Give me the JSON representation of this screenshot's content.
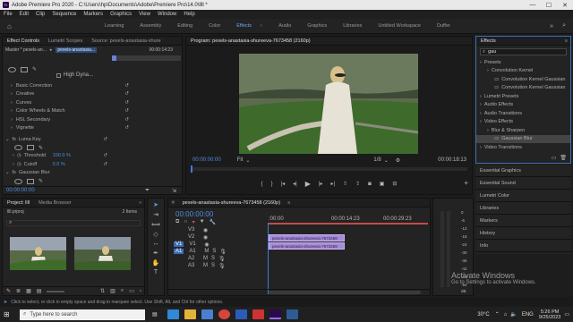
{
  "window": {
    "title": "Adobe Premiere Pro 2020 - C:\\Users\\hp\\Documents\\Adobe\\Premiere Pro\\14.0\\llll *",
    "min": "—",
    "max": "☐",
    "close": "✕"
  },
  "menu": [
    "File",
    "Edit",
    "Clip",
    "Sequence",
    "Markers",
    "Graphics",
    "View",
    "Window",
    "Help"
  ],
  "workspaces": [
    "Learning",
    "Assembly",
    "Editing",
    "Color",
    "Effects",
    "Audio",
    "Graphics",
    "Libraries",
    "Untitled Workspace",
    "Duffer"
  ],
  "workspace_active": "Effects",
  "effect_controls": {
    "tabs": [
      "Effect Controls",
      "Lumetri Scopes",
      "Source: pexels-anastasia-shure"
    ],
    "master": "Master * pexels-an...",
    "clip": "pexels-anastasia...",
    "timecode": "00:00:14:23",
    "high_dynamic": "High Dyna...",
    "props": [
      "Basic Correction",
      "Creative",
      "Curves",
      "Color Wheels & Match",
      "HSL Secondary",
      "Vignette"
    ],
    "luma_key": "Luma Key",
    "threshold_label": "Threshold",
    "threshold_val": "100.0 %",
    "cutoff_label": "Cutoff",
    "cutoff_val": "0.0 %",
    "gaussian": "Gaussian Blur",
    "bottom_tc": "00:00:00:00"
  },
  "program": {
    "title": "Program: pexels-anastasia-shureeva-7673458 (2160p)",
    "tc_left": "00:00:00:00",
    "fit": "Fit",
    "fraction": "1/8",
    "tc_right": "00:00:18:13"
  },
  "project": {
    "tabs": [
      "Project: llll",
      "Media Browser"
    ],
    "file": "llll.prproj",
    "items": "2 Items"
  },
  "timeline": {
    "title": "pexels-anastasia-shureeva-7673458 (2160p)",
    "tc": "00:00:00:00",
    "ruler": [
      ":00:00",
      "00:00:14:23",
      "00:00:29:23"
    ],
    "tracks": [
      "V3",
      "V2",
      "V1",
      "A1",
      "A2",
      "A3"
    ],
    "clip_v2": "pexels-anastasia-shureeva-7673458",
    "clip_v1": "pexels-anastasia-shureeva-7673458",
    "source_v": "V1",
    "source_a": "A1",
    "db": [
      "0",
      "-6",
      "-12",
      "-18",
      "-24",
      "-30",
      "-36",
      "-42",
      "-48",
      "-54"
    ],
    "db_bottom": "dB"
  },
  "effects": {
    "title": "Effects",
    "search": "gau",
    "tree": [
      {
        "label": "Presets",
        "lvl": 0
      },
      {
        "label": "Convolution Kernel",
        "lvl": 1
      },
      {
        "label": "Convolution Kernel Gaussian",
        "lvl": 2
      },
      {
        "label": "Convolution Kernel Gaussian",
        "lvl": 2
      },
      {
        "label": "Lumetri Presets",
        "lvl": 0
      },
      {
        "label": "Audio Effects",
        "lvl": 0
      },
      {
        "label": "Audio Transitions",
        "lvl": 0
      },
      {
        "label": "Video Effects",
        "lvl": 0
      },
      {
        "label": "Blur & Sharpen",
        "lvl": 1
      },
      {
        "label": "Gaussian Blur",
        "lvl": 2,
        "sel": true
      },
      {
        "label": "Video Transitions",
        "lvl": 0
      }
    ],
    "other_panels": [
      "Essential Graphics",
      "Essential Sound",
      "Lumetri Color",
      "Libraries",
      "Markers",
      "History",
      "Info"
    ]
  },
  "status": "Click to select, or click in empty space and drag to marquee select. Use Shift, Alt, and Ctrl for other options.",
  "activate": {
    "title": "Activate Windows",
    "sub": "Go to Settings to activate Windows."
  },
  "taskbar": {
    "search": "Type here to search",
    "temp": "30°C",
    "lang": "ENG",
    "time": "5:26 PM",
    "date": "9/25/2023"
  }
}
